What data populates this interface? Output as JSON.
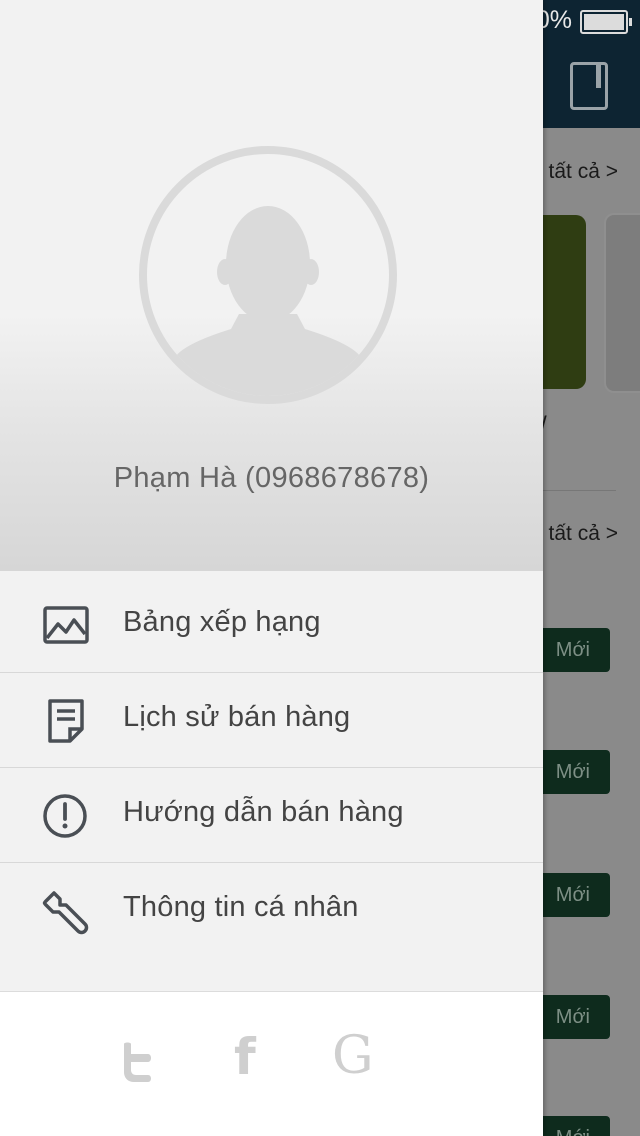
{
  "status_bar": {
    "battery_text": "0%"
  },
  "background": {
    "see_all_1": "tất cả >",
    "see_all_2": "tất cả >",
    "partial_text": "/",
    "badges": [
      "Mới",
      "Mới",
      "Mới",
      "Mới",
      "Mới"
    ]
  },
  "drawer": {
    "profile": {
      "name": "Phạm Hà (0968678678)"
    },
    "menu": [
      {
        "label": "Bảng xếp hạng",
        "icon": "chart-image-icon"
      },
      {
        "label": "Lịch sử bán hàng",
        "icon": "document-history-icon"
      },
      {
        "label": "Hướng dẫn bán hàng",
        "icon": "exclamation-circle-icon"
      },
      {
        "label": "Thông tin cá nhân",
        "icon": "wrench-icon"
      }
    ],
    "social": [
      {
        "icon": "twitter-icon"
      },
      {
        "icon": "facebook-icon"
      },
      {
        "icon": "google-icon"
      }
    ]
  },
  "colors": {
    "header": "#0d2432",
    "drawer_bg": "#f2f2f2",
    "menu_text": "#444444",
    "icon": "#4a4f55",
    "badge": "#0e2b1d"
  }
}
